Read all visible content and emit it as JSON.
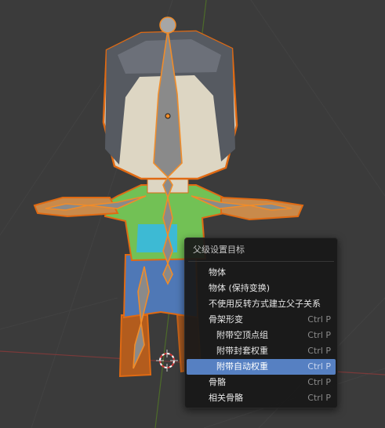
{
  "viewport": {
    "colors": {
      "background": "#3b3b3b",
      "selection_outline": "#e06a13",
      "bone_fill": "#8a8a8a",
      "bone_outline": "#f08c2a",
      "axis_x": "#7a3a3a",
      "axis_y": "#4d6b2a",
      "skin": "#ddd6c3",
      "hair": "#565a61",
      "shirt": "#72c155",
      "shirt_pocket": "#3dbad4",
      "pants": "#4f78b6"
    },
    "icons": [
      "cursor-3d-icon",
      "bone-head-icon",
      "object-origin-icon"
    ]
  },
  "context_menu": {
    "title": "父级设置目标",
    "items": [
      {
        "label": "物体",
        "shortcut": "",
        "indent": false,
        "active": false
      },
      {
        "label": "物体 (保持变换)",
        "shortcut": "",
        "indent": false,
        "active": false
      },
      {
        "label": "不使用反转方式建立父子关系",
        "shortcut": "",
        "indent": false,
        "active": false
      },
      {
        "label": "骨架形变",
        "shortcut": "Ctrl P",
        "indent": false,
        "active": false
      },
      {
        "label": "附带空顶点组",
        "shortcut": "Ctrl P",
        "indent": true,
        "active": false
      },
      {
        "label": "附带封套权重",
        "shortcut": "Ctrl P",
        "indent": true,
        "active": false
      },
      {
        "label": "附带自动权重",
        "shortcut": "Ctrl P",
        "indent": true,
        "active": true
      },
      {
        "label": "骨骼",
        "shortcut": "Ctrl P",
        "indent": false,
        "active": false
      },
      {
        "label": "相关骨骼",
        "shortcut": "Ctrl P",
        "indent": false,
        "active": false
      }
    ]
  }
}
